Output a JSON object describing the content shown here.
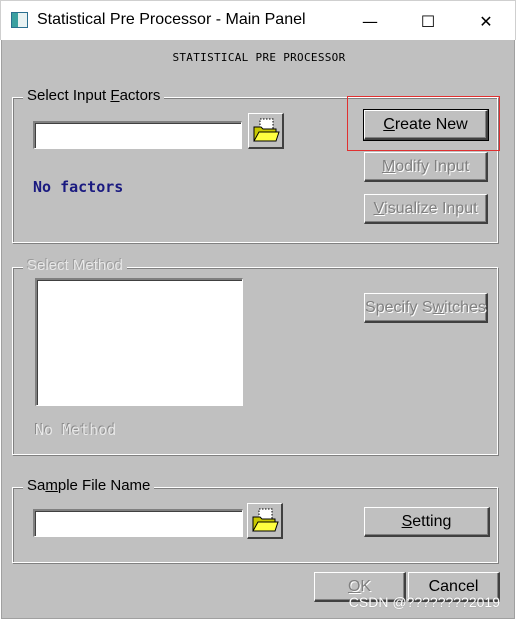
{
  "window": {
    "title": "Statistical Pre Processor - Main Panel",
    "controls": {
      "minimize": "—",
      "maximize": "☐",
      "close": "✕"
    }
  },
  "header": {
    "text": "STATISTICAL PRE PROCESSOR"
  },
  "input_factors": {
    "legend_pre": "Select Input ",
    "legend_key": "F",
    "legend_post": "actors",
    "field_value": "",
    "status": "No factors",
    "status_color": "#1a1a80",
    "create_new_pre": "",
    "create_new_key": "C",
    "create_new_post": "reate New",
    "modify_pre": "",
    "modify_key": "M",
    "modify_post": "odify Input",
    "visualize_pre": "",
    "visualize_key": "V",
    "visualize_post": "isualize Input"
  },
  "method": {
    "legend": "Select Method",
    "status": "No Method",
    "specify_pre": "Specify S",
    "specify_key": "w",
    "specify_post": "itches"
  },
  "sample": {
    "legend_pre": "Sa",
    "legend_key": "m",
    "legend_post": "ple File Name",
    "field_value": "",
    "setting_pre": "",
    "setting_key": "S",
    "setting_post": "etting"
  },
  "footer": {
    "ok_key": "O",
    "ok_post": "K",
    "cancel": "Cancel",
    "watermark": "CSDN @????????2019"
  },
  "colors": {
    "highlight": "#e03030",
    "dialog_bg": "#c0c0c0"
  }
}
